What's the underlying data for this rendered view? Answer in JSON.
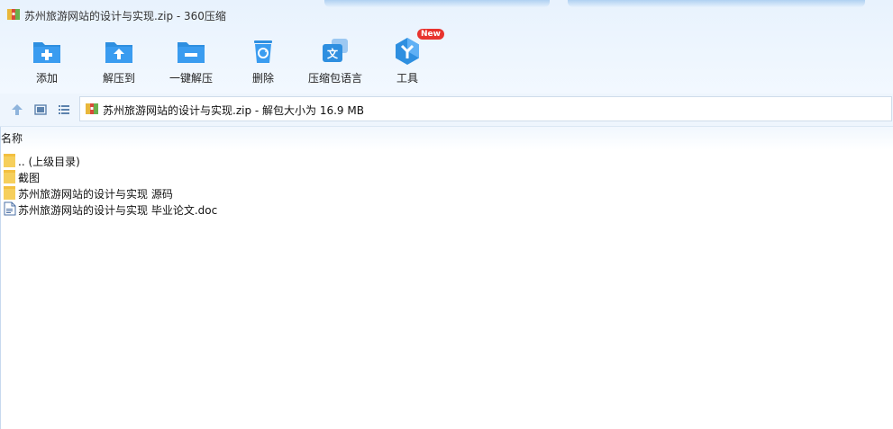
{
  "window": {
    "title": "苏州旅游网站的设计与实现.zip - 360压缩"
  },
  "toolbar": {
    "items": [
      {
        "label": "添加",
        "icon": "add-folder-icon"
      },
      {
        "label": "解压到",
        "icon": "extract-to-icon"
      },
      {
        "label": "一键解压",
        "icon": "one-click-extract-icon"
      },
      {
        "label": "删除",
        "icon": "trash-icon"
      },
      {
        "label": "压缩包语言",
        "icon": "language-icon"
      },
      {
        "label": "工具",
        "icon": "tools-icon",
        "badge": "New"
      }
    ]
  },
  "address": {
    "text": "苏州旅游网站的设计与实现.zip - 解包大小为 16.9 MB"
  },
  "list": {
    "column_name": "名称",
    "rows": [
      {
        "name": ".. (上级目录)",
        "type": "folder"
      },
      {
        "name": "截图",
        "type": "folder"
      },
      {
        "name": "苏州旅游网站的设计与实现  源码",
        "type": "folder"
      },
      {
        "name": "苏州旅游网站的设计与实现 毕业论文.doc",
        "type": "doc"
      }
    ]
  },
  "colors": {
    "accent": "#2e8fe0",
    "folder": "#f6cf5c",
    "badge": "#e8332e"
  }
}
